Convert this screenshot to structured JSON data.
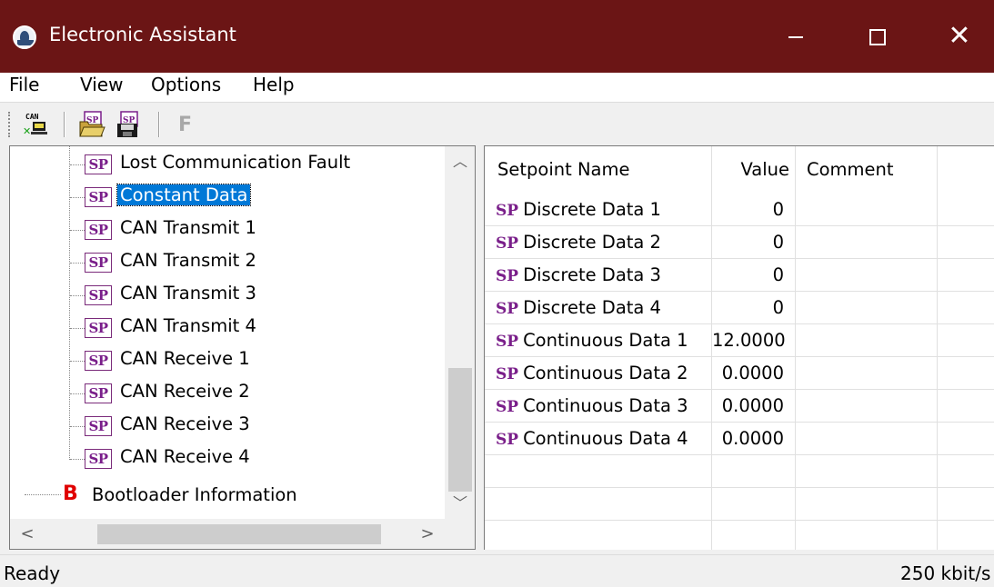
{
  "window": {
    "title": "Electronic Assistant"
  },
  "menu": [
    "File",
    "View",
    "Options",
    "Help"
  ],
  "toolbar": {
    "f_label": "F",
    "can_label": "CAN",
    "sp_label": "SP"
  },
  "tree": {
    "badge": "SP",
    "items": [
      "Lost Communication Fault",
      "Constant Data",
      "CAN Transmit 1",
      "CAN Transmit 2",
      "CAN Transmit 3",
      "CAN Transmit 4",
      "CAN Receive 1",
      "CAN Receive 2",
      "CAN Receive 3",
      "CAN Receive 4"
    ],
    "selected_index": 1,
    "bootloader": {
      "badge": "B",
      "label": "Bootloader Information"
    }
  },
  "grid": {
    "headers": {
      "name": "Setpoint Name",
      "value": "Value",
      "comment": "Comment"
    },
    "badge": "SP",
    "rows": [
      {
        "name": "Discrete Data 1",
        "value": "0",
        "comment": ""
      },
      {
        "name": "Discrete Data 2",
        "value": "0",
        "comment": ""
      },
      {
        "name": "Discrete Data 3",
        "value": "0",
        "comment": ""
      },
      {
        "name": "Discrete Data 4",
        "value": "0",
        "comment": ""
      },
      {
        "name": "Continuous Data 1",
        "value": "12.0000",
        "comment": ""
      },
      {
        "name": "Continuous Data 2",
        "value": "0.0000",
        "comment": ""
      },
      {
        "name": "Continuous Data 3",
        "value": "0.0000",
        "comment": ""
      },
      {
        "name": "Continuous Data 4",
        "value": "0.0000",
        "comment": ""
      }
    ]
  },
  "status": {
    "left": "Ready",
    "right": "250 kbit/s"
  },
  "colors": {
    "titlebar": "#6b1515",
    "selection": "#0078d7",
    "sp_badge": "#7a1f8a",
    "bootloader_badge": "#e00000"
  }
}
